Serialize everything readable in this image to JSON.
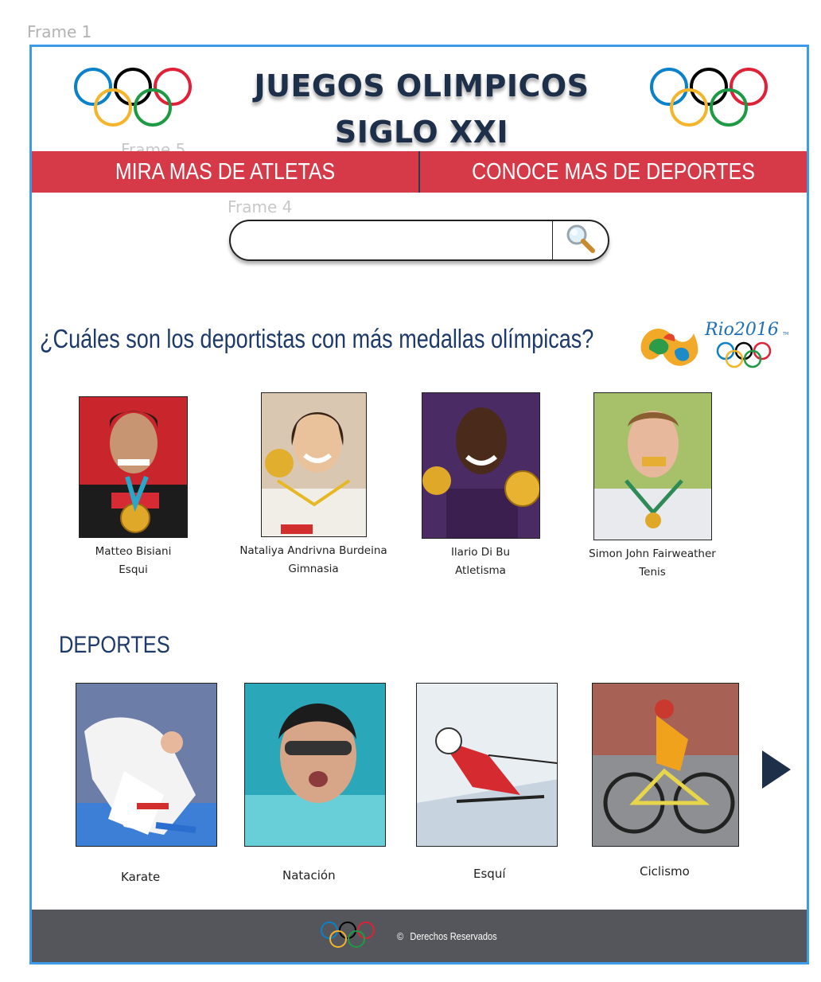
{
  "canvas": {
    "frame_labels": [
      "Frame 1",
      "Frame 5",
      "Frame 4"
    ]
  },
  "header": {
    "title_line1": "JUEGOS OLIMPICOS",
    "title_line2": "SIGLO XXI",
    "left_logo_icon": "olympic-rings-icon",
    "right_logo_icon": "olympic-rings-icon"
  },
  "nav": {
    "athletes_label": "MIRA MAS DE ATLETAS",
    "sports_label": "CONOCE MAS DE DEPORTES",
    "bar_color": "#d63a48"
  },
  "search": {
    "value": "",
    "placeholder": "",
    "icon": "magnifier-icon"
  },
  "medalists": {
    "question": "¿Cuáles son los deportistas con más medallas olímpicas?",
    "logo_text": "Rio2016",
    "logo_tm": "TM",
    "athletes": [
      {
        "name": "Matteo Bisiani",
        "sport": "Esqui"
      },
      {
        "name": "Nataliya Andrivna Burdeina",
        "sport": "Gimnasia"
      },
      {
        "name": "Ilario Di Bu",
        "sport": "Atletisma"
      },
      {
        "name": "Simon John Fairweather",
        "sport": "Tenis"
      }
    ]
  },
  "sports": {
    "title": "DEPORTES",
    "items": [
      {
        "label": "Karate"
      },
      {
        "label": "Natación"
      },
      {
        "label": "Esquí"
      },
      {
        "label": "Ciclismo"
      }
    ],
    "next_icon": "triangle-right-icon"
  },
  "footer": {
    "copyright_symbol": "©",
    "text": "Derechos Reservados",
    "background": "#54565b"
  },
  "colors": {
    "frame_border": "#3d9be9",
    "title": "#1e2f4a",
    "heading": "#1e3a6a"
  }
}
